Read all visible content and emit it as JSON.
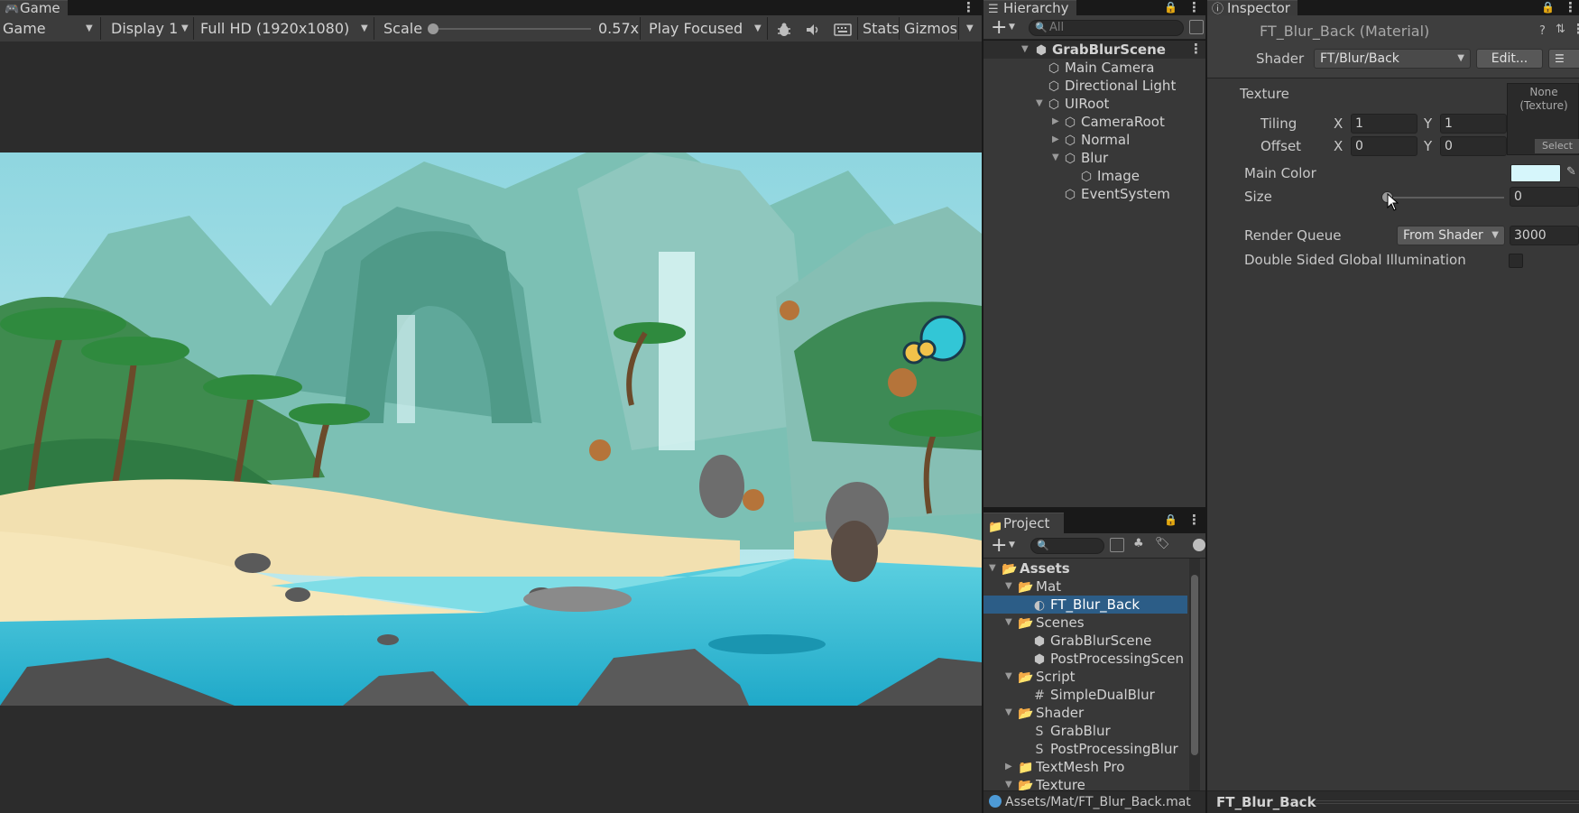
{
  "game_panel": {
    "tab_label": "Game",
    "view_mode": "Game",
    "display": "Display 1",
    "resolution": "Full HD (1920x1080)",
    "scale_label": "Scale",
    "scale_value": "0.57x",
    "scale_fraction": 0.0,
    "play_mode": "Play Focused",
    "stats_label": "Stats",
    "gizmos_label": "Gizmos"
  },
  "hierarchy": {
    "tab_label": "Hierarchy",
    "search_placeholder": "All",
    "scene_name": "GrabBlurScene",
    "items": [
      {
        "label": "Main Camera"
      },
      {
        "label": "Directional Light"
      },
      {
        "label": "UIRoot"
      },
      {
        "label": "CameraRoot"
      },
      {
        "label": "Normal"
      },
      {
        "label": "Blur"
      },
      {
        "label": "Image"
      },
      {
        "label": "EventSystem"
      }
    ]
  },
  "project": {
    "tab_label": "Project",
    "root": "Assets",
    "items": [
      {
        "label": "Mat"
      },
      {
        "label": "FT_Blur_Back"
      },
      {
        "label": "Scenes"
      },
      {
        "label": "GrabBlurScene"
      },
      {
        "label": "PostProcessingScen"
      },
      {
        "label": "Script"
      },
      {
        "label": "SimpleDualBlur"
      },
      {
        "label": "Shader"
      },
      {
        "label": "GrabBlur"
      },
      {
        "label": "PostProcessingBlur"
      },
      {
        "label": "TextMesh Pro"
      },
      {
        "label": "Texture"
      }
    ],
    "path": "Assets/Mat/FT_Blur_Back.mat"
  },
  "inspector": {
    "tab_label": "Inspector",
    "title": "FT_Blur_Back (Material)",
    "shader_label": "Shader",
    "shader_value": "FT/Blur/Back",
    "edit_button": "Edit...",
    "texture_label": "Texture",
    "texture_slot_line1": "None",
    "texture_slot_line2": "(Texture)",
    "texture_select": "Select",
    "tiling_label": "Tiling",
    "offset_label": "Offset",
    "x_label": "X",
    "y_label": "Y",
    "tiling_x": "1",
    "tiling_y": "1",
    "offset_x": "0",
    "offset_y": "0",
    "main_color_label": "Main Color",
    "main_color": "#d6f6fb",
    "size_label": "Size",
    "size_value": "0",
    "render_queue_label": "Render Queue",
    "render_queue_mode": "From Shader",
    "render_queue_value": "3000",
    "dsgi_label": "Double Sided Global Illumination",
    "footer_name": "FT_Blur_Back"
  },
  "colors": {
    "panel_bg": "#383838",
    "toolbar_bg": "#3c3c3c",
    "selection": "#2c5d87",
    "accent": "#4d9ad6"
  }
}
